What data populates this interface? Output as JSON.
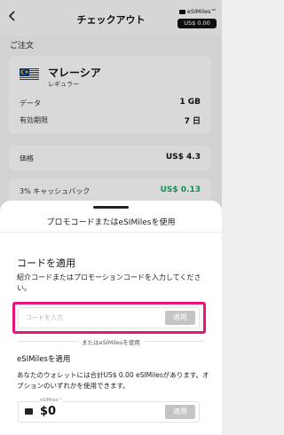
{
  "header": {
    "back_icon": "chevron-left-icon",
    "title": "チェックアウト",
    "wallet": {
      "brand": "eSIMiles™",
      "balance": "US$ 0.00"
    }
  },
  "order": {
    "section_label": "ご注文",
    "country": "マレーシア",
    "plan_type": "レギュラー",
    "rows": [
      {
        "label": "データ",
        "value": "1 GB"
      },
      {
        "label": "有効期限",
        "value": "7 日"
      }
    ]
  },
  "price": {
    "label": "価格",
    "value": "US$ 4.3"
  },
  "cashback": {
    "label": "3% キャッシュバック",
    "value": "US$ 0.13",
    "color": "#1aa35f"
  },
  "sheet": {
    "title": "プロモコードまたはeSIMilesを使用",
    "code_heading": "コードを適用",
    "code_desc": "紹介コードまたはプロモーションコードを入力してください。",
    "code_placeholder": "コードを入力",
    "apply_label": "適用",
    "divider_text": "またはeSIMilesを使用",
    "miles_heading": "eSIMilesを適用",
    "miles_desc": "あなたのウォレットには合計US$ 0.00 eSIMilesがあります。オプションのいずれかを使用できます。",
    "miles_brand": "eSIMiles™",
    "miles_value": "$0",
    "miles_apply_label": "適用"
  },
  "colors": {
    "highlight": "#e8157a",
    "cashback": "#1aa35f"
  }
}
